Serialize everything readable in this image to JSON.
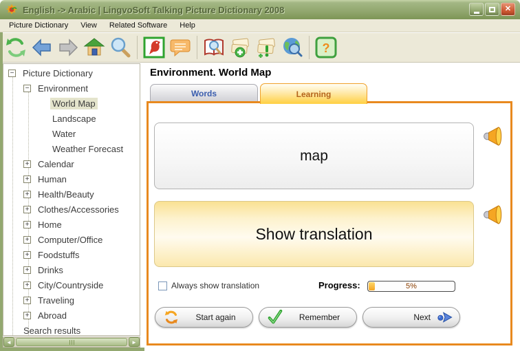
{
  "window": {
    "title": "English -> Arabic | LingvoSoft Talking Picture Dictionary 2008",
    "controls": {
      "close_glyph": "✕"
    }
  },
  "menu": {
    "items": [
      {
        "label": "Picture Dictionary"
      },
      {
        "label": "View"
      },
      {
        "label": "Related Software"
      },
      {
        "label": "Help"
      }
    ]
  },
  "toolbar": {
    "buttons": [
      {
        "name": "refresh"
      },
      {
        "name": "back"
      },
      {
        "name": "forward"
      },
      {
        "name": "home"
      },
      {
        "name": "search"
      },
      {
        "name": "picture-dictionary"
      },
      {
        "name": "talk"
      },
      {
        "name": "dictionary-search"
      },
      {
        "name": "add-word"
      },
      {
        "name": "learning-list"
      },
      {
        "name": "online-globe"
      },
      {
        "name": "help"
      }
    ]
  },
  "tree": {
    "items": [
      {
        "label": "Picture Dictionary",
        "level": 0,
        "expand": "minus",
        "selected": false
      },
      {
        "label": "Environment",
        "level": 1,
        "expand": "minus",
        "selected": false
      },
      {
        "label": "World Map",
        "level": 2,
        "expand": "none",
        "selected": true
      },
      {
        "label": "Landscape",
        "level": 2,
        "expand": "none",
        "selected": false
      },
      {
        "label": "Water",
        "level": 2,
        "expand": "none",
        "selected": false
      },
      {
        "label": "Weather Forecast",
        "level": 2,
        "expand": "none",
        "selected": false
      },
      {
        "label": "Calendar",
        "level": 1,
        "expand": "plus",
        "selected": false
      },
      {
        "label": "Human",
        "level": 1,
        "expand": "plus",
        "selected": false
      },
      {
        "label": "Health/Beauty",
        "level": 1,
        "expand": "plus",
        "selected": false
      },
      {
        "label": "Clothes/Accessories",
        "level": 1,
        "expand": "plus",
        "selected": false
      },
      {
        "label": "Home",
        "level": 1,
        "expand": "plus",
        "selected": false
      },
      {
        "label": "Computer/Office",
        "level": 1,
        "expand": "plus",
        "selected": false
      },
      {
        "label": "Foodstuffs",
        "level": 1,
        "expand": "plus",
        "selected": false
      },
      {
        "label": "Drinks",
        "level": 1,
        "expand": "plus",
        "selected": false
      },
      {
        "label": "City/Countryside",
        "level": 1,
        "expand": "plus",
        "selected": false
      },
      {
        "label": "Traveling",
        "level": 1,
        "expand": "plus",
        "selected": false
      },
      {
        "label": "Abroad",
        "level": 1,
        "expand": "plus",
        "selected": false
      },
      {
        "label": "Search results",
        "level": 1,
        "expand": "none",
        "selected": false
      }
    ],
    "scroll": {
      "left_glyph": "◄",
      "right_glyph": "►"
    }
  },
  "main": {
    "heading": "Environment. World Map",
    "tabs": [
      {
        "label": "Words",
        "active": false
      },
      {
        "label": "Learning",
        "active": true
      }
    ],
    "word": "map",
    "translation_button": "Show translation",
    "checkbox": {
      "label": "Always show translation",
      "checked": false
    },
    "progress": {
      "label": "Progress:",
      "percent_text": "5%",
      "value": 5
    },
    "buttons": [
      {
        "label": "Start again",
        "icon": "restart-icon"
      },
      {
        "label": "Remember",
        "icon": "check-icon"
      },
      {
        "label": "Next",
        "icon": "next-arrow-icon"
      }
    ],
    "speaker_icon": "speaker-icon"
  },
  "colors": {
    "accent_orange": "#E8891E",
    "titlebar_olive": "#93A870",
    "toolbar_beige": "#ECE9D8",
    "learning_tab_yellow": "#FFD24A",
    "learning_tab_text": "#B5651D",
    "words_tab_text": "#3A5DAE",
    "tree_selected_bg": "#E4E4CC",
    "progress_fill": "#F5A623",
    "progress_text": "#8B3E00"
  }
}
